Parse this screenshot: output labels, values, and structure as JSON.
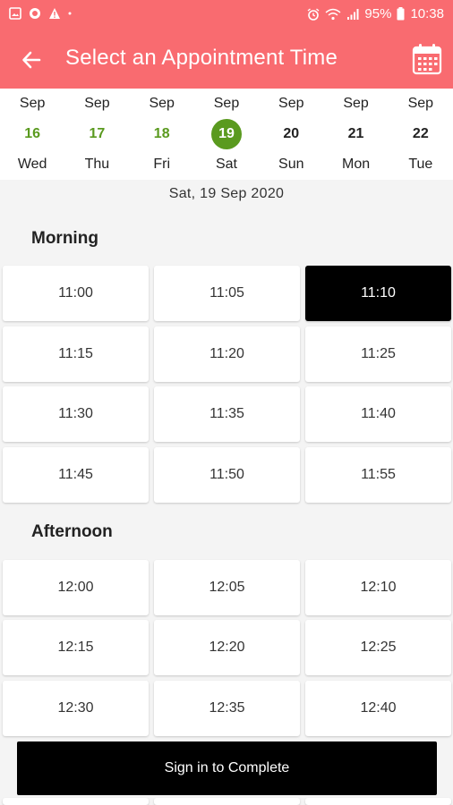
{
  "status_bar": {
    "battery": "95%",
    "time": "10:38"
  },
  "app_bar": {
    "title": "Select an Appointment Time"
  },
  "dates": [
    {
      "month": "Sep",
      "day": "16",
      "weekday": "Wed",
      "state": "available"
    },
    {
      "month": "Sep",
      "day": "17",
      "weekday": "Thu",
      "state": "available"
    },
    {
      "month": "Sep",
      "day": "18",
      "weekday": "Fri",
      "state": "available"
    },
    {
      "month": "Sep",
      "day": "19",
      "weekday": "Sat",
      "state": "selected"
    },
    {
      "month": "Sep",
      "day": "20",
      "weekday": "Sun",
      "state": "normal"
    },
    {
      "month": "Sep",
      "day": "21",
      "weekday": "Mon",
      "state": "normal"
    },
    {
      "month": "Sep",
      "day": "22",
      "weekday": "Tue",
      "state": "normal"
    }
  ],
  "selected_date_label": "Sat, 19 Sep 2020",
  "morning": {
    "title": "Morning",
    "slots": [
      "11:00",
      "11:05",
      "11:10",
      "11:15",
      "11:20",
      "11:25",
      "11:30",
      "11:35",
      "11:40",
      "11:45",
      "11:50",
      "11:55"
    ],
    "selected": "11:10"
  },
  "afternoon": {
    "title": "Afternoon",
    "slots": [
      "12:00",
      "12:05",
      "12:10",
      "12:15",
      "12:20",
      "12:25",
      "12:30",
      "12:35",
      "12:40"
    ]
  },
  "cta_label": "Sign in to Complete",
  "colors": {
    "header": "#f96b70",
    "available_date": "#5a9a1f",
    "selected_slot": "#000000"
  }
}
